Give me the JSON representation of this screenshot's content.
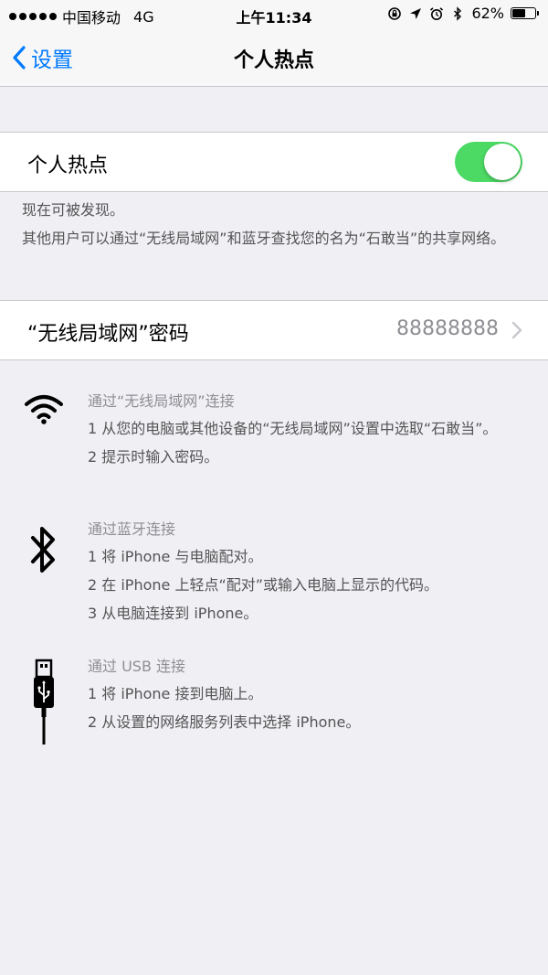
{
  "status_bar": {
    "carrier": "中国移动",
    "network": "4G",
    "time": "上午11:34",
    "battery_percent": "62%",
    "battery_level": 0.62
  },
  "nav": {
    "back_label": "设置",
    "title": "个人热点"
  },
  "hotspot": {
    "toggle_label": "个人热点",
    "toggle_on": true,
    "discoverable": "现在可被发现。",
    "description": "其他用户可以通过“无线局域网”和蓝牙查找您的名为“石敢当”的共享网络。"
  },
  "wifi_password": {
    "label": "“无线局域网”密码",
    "value": "88888888"
  },
  "help": {
    "wifi": {
      "title": "通过“无线局域网”连接",
      "steps": [
        "1 从您的电脑或其他设备的“无线局域网”设置中选取“石敢当”。",
        "2 提示时输入密码。"
      ]
    },
    "bluetooth": {
      "title": "通过蓝牙连接",
      "steps": [
        "1 将 iPhone 与电脑配对。",
        "2 在 iPhone 上轻点“配对”或输入电脑上显示的代码。",
        "3 从电脑连接到 iPhone。"
      ]
    },
    "usb": {
      "title": "通过 USB 连接",
      "steps": [
        "1 将 iPhone 接到电脑上。",
        "2 从设置的网络服务列表中选择 iPhone。"
      ]
    }
  },
  "icons": {
    "back": "chevron-left-icon",
    "disclosure": "chevron-right-icon",
    "wifi": "wifi-icon",
    "bluetooth": "bluetooth-icon",
    "usb": "usb-cable-icon"
  },
  "colors": {
    "accent": "#007aff",
    "toggle_on": "#4cd964",
    "background": "#efeff4"
  }
}
